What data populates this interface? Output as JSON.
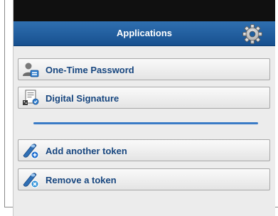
{
  "appbar": {
    "title": "Applications",
    "settings_icon": "gear-icon"
  },
  "menu": {
    "items": [
      {
        "label": "One-Time Password",
        "icon": "user-key-icon"
      },
      {
        "label": "Digital Signature",
        "icon": "signed-document-icon"
      }
    ],
    "token_actions": [
      {
        "label": "Add another token",
        "icon": "add-token-icon"
      },
      {
        "label": "Remove a token",
        "icon": "remove-token-icon"
      }
    ]
  },
  "colors": {
    "appbar": "#1f5fa0",
    "label": "#17467f",
    "divider": "#3a7bc6",
    "statusbar": "#101010"
  }
}
